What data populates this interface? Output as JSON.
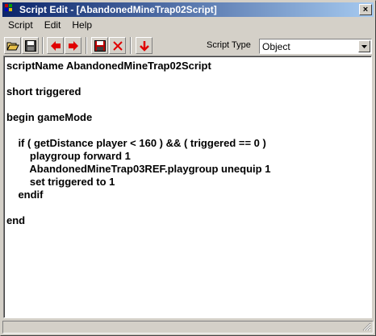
{
  "window": {
    "title": "Script Edit - [AbandonedMineTrap02Script]",
    "close_glyph": "×"
  },
  "menu": [
    "Script",
    "Edit",
    "Help"
  ],
  "toolbar": {
    "buttons": [
      {
        "name": "open-button",
        "icon": "folder-open-icon"
      },
      {
        "name": "save-button",
        "icon": "floppy-disk-icon"
      },
      {
        "name": "previous-script-button",
        "icon": "arrow-left-icon"
      },
      {
        "name": "next-script-button",
        "icon": "arrow-right-icon"
      },
      {
        "name": "save-red-button",
        "icon": "red-floppy-icon"
      },
      {
        "name": "delete-button",
        "icon": "red-x-icon"
      },
      {
        "name": "compile-button",
        "icon": "arrow-down-icon"
      }
    ],
    "script_type_label": "Script Type",
    "script_type_value": "Object"
  },
  "colors": {
    "title_start": "#0a246a",
    "title_end": "#a6caf0",
    "arrow_red": "#e00000",
    "window_bg": "#d4d0c8"
  },
  "editor": {
    "lines": [
      "scriptName AbandonedMineTrap02Script",
      "",
      "short triggered",
      "",
      "begin gameMode",
      "",
      "    if ( getDistance player < 160 ) && ( triggered == 0 )",
      "        playgroup forward 1",
      "        AbandonedMineTrap03REF.playgroup unequip 1",
      "        set triggered to 1",
      "    endif",
      "",
      "end"
    ]
  }
}
